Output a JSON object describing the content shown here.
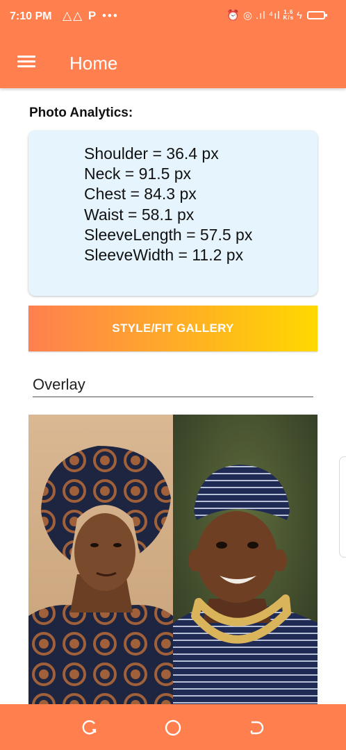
{
  "status_bar": {
    "time": "7:10 PM",
    "left_icons": [
      "warning-icon",
      "warning-icon",
      "parking-icon",
      "more-dots-icon"
    ],
    "speed_top": "1.6",
    "speed_bottom": "K/s",
    "right_icons": [
      "alarm-icon",
      "hotspot-icon",
      "signal-icon",
      "4g-signal-icon",
      "battery-charging-icon"
    ]
  },
  "app_bar": {
    "title": "Home",
    "menu_icon": "hamburger-menu-icon",
    "color": "#FF7F4F"
  },
  "analytics": {
    "heading": "Photo Analytics:",
    "lines": [
      "Shoulder = 36.4 px",
      "Neck = 91.5 px",
      "Chest = 84.3 px",
      "Waist = 58.1 px",
      "SleeveLength = 57.5 px",
      "SleeveWidth = 11.2 px"
    ],
    "card_color": "#E5F4FD"
  },
  "gallery_button": {
    "label": "STYLE/FIT GALLERY",
    "gradient": [
      "#FF7F4F",
      "#FFD800"
    ]
  },
  "dropdown": {
    "selected": "Overlay"
  },
  "photo": {
    "description_icon": "overlay-photo"
  },
  "nav_bar": {
    "buttons": [
      "recent-apps-icon",
      "home-icon",
      "back-icon"
    ],
    "color": "#FF7F4F"
  }
}
